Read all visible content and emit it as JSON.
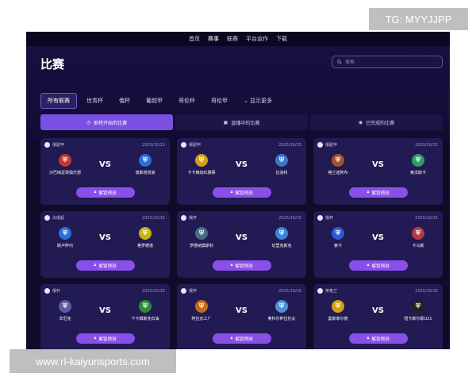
{
  "watermark": {
    "tg": "TG: MYYJJPP",
    "url": "www.rl-kaiyunsports.com"
  },
  "nav": {
    "items": [
      "首页",
      "赛事",
      "联赛",
      "平台运作",
      "下载"
    ],
    "active_index": 1
  },
  "page": {
    "title": "比赛"
  },
  "search": {
    "placeholder": "搜索"
  },
  "tabs": {
    "items": [
      "所有联赛",
      "世青杯",
      "俄杯",
      "葡超甲",
      "哥伦杯",
      "哥伦甲",
      "显示更多"
    ],
    "active_index": 0
  },
  "status_tabs": {
    "items": [
      "即将开始的比赛",
      "直播中的比赛",
      "已完成的比赛"
    ],
    "active_index": 0
  },
  "colors": {
    "accent": "#7b4fe2",
    "button": "#8a4fe8",
    "card": "#221a52",
    "background": "#0f0b2a"
  },
  "predict_label": "解锁预测",
  "vs_label": "VS",
  "matches": [
    {
      "league": "俄超甲",
      "date": "2025/10/15",
      "home": "沙巴纳足球俱乐部",
      "away": "波斯塔流浪",
      "home_color": "#c0392b",
      "away_color": "#2b6fd6"
    },
    {
      "league": "俄超甲",
      "date": "2025/10/15",
      "home": "卡卡梅加红霹雳",
      "away": "比洛科",
      "home_color": "#d4a017",
      "away_color": "#3a78c9"
    },
    {
      "league": "俄超甲",
      "date": "2025/10/15",
      "home": "格兰迪阿布",
      "away": "索法斯卡",
      "home_color": "#a0522d",
      "away_color": "#2e9c6a"
    },
    {
      "league": "白俄超",
      "date": "2025/10/15",
      "home": "斯卢萨内",
      "away": "格罗德诺",
      "home_color": "#2b6fd6",
      "away_color": "#c9b21c"
    },
    {
      "league": "俄杯",
      "date": "2025/10/15",
      "home": "罗德纳莫斯科",
      "away": "切里克斯克",
      "home_color": "#4a6b8a",
      "away_color": "#3b84d8"
    },
    {
      "league": "俄杯",
      "date": "2025/10/15",
      "home": "索卡",
      "away": "卡马斯",
      "home_color": "#2d5bd1",
      "away_color": "#b23a48"
    },
    {
      "league": "俄杯",
      "date": "2025/10/15",
      "home": "辛厄克",
      "away": "下卡姆斯克石油",
      "home_color": "#5a5a9e",
      "away_color": "#2e8b3e"
    },
    {
      "league": "俄杯",
      "date": "2025/10/16",
      "home": "阿拉瓦工厂",
      "away": "奥科尔萨拉托夫",
      "home_color": "#c46a1c",
      "away_color": "#4f8fd6"
    },
    {
      "league": "英格兰",
      "date": "2025/10/16",
      "home": "曼斯菲尔德",
      "away": "纽卡斯尔联U21",
      "home_color": "#d4a017",
      "away_color": "#222222"
    }
  ]
}
